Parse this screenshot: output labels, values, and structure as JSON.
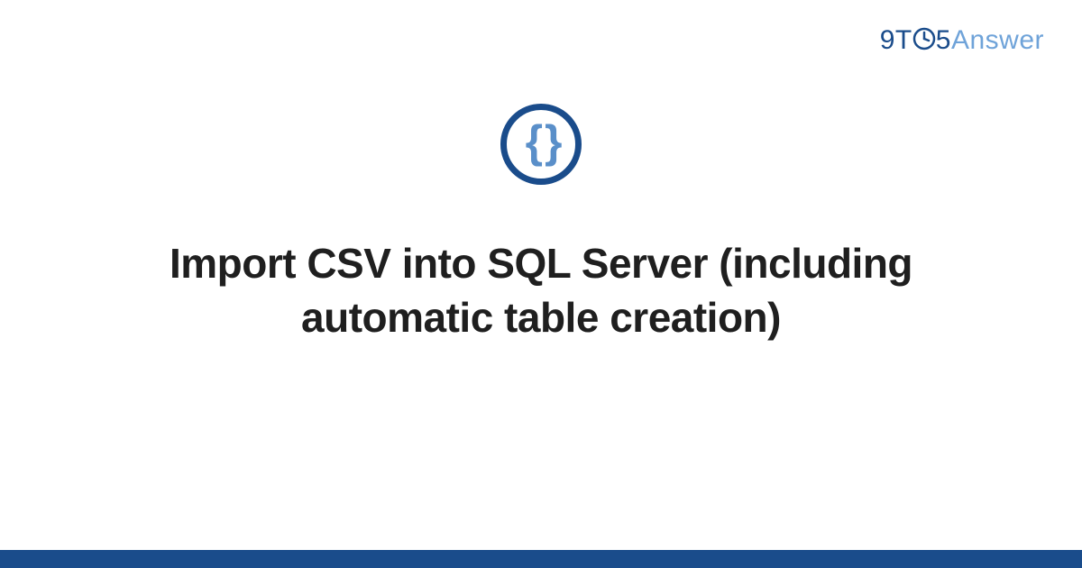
{
  "brand": {
    "prefix": "9T",
    "middle": "5",
    "suffix": "Answer"
  },
  "category_icon": {
    "name": "code-braces-icon",
    "glyph": "{ }"
  },
  "title": "Import CSV into SQL Server (including automatic table creation)",
  "colors": {
    "brand_primary": "#1a4c8b",
    "brand_light": "#6fa3d9",
    "icon_fill": "#5a8fc9",
    "text": "#1f1f1f"
  }
}
